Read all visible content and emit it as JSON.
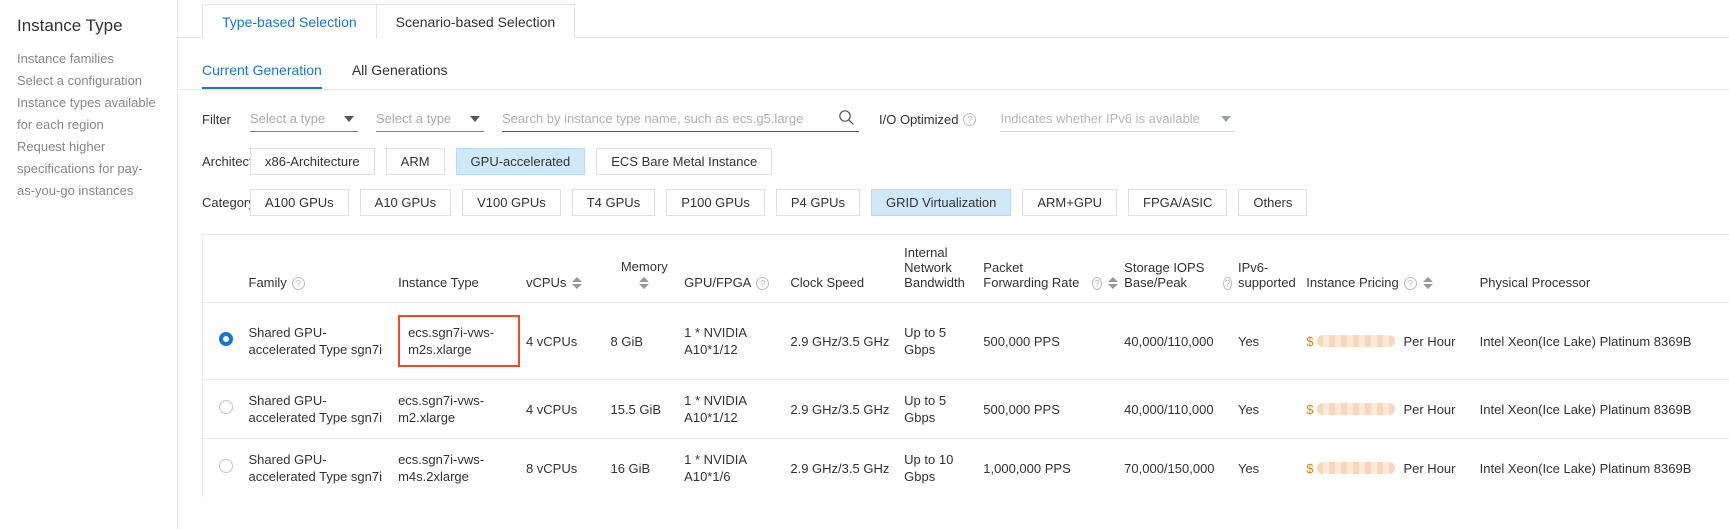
{
  "sidebar": {
    "title": "Instance Type",
    "items": [
      {
        "label": "Instance families"
      },
      {
        "label": "Select a configuration"
      },
      {
        "label": "Instance types available"
      },
      {
        "label": "for each region"
      },
      {
        "label": "Request higher"
      },
      {
        "label": "specifications for pay-"
      },
      {
        "label": "as-you-go instances"
      }
    ]
  },
  "top_tabs": [
    {
      "label": "Type-based Selection",
      "active": true
    },
    {
      "label": "Scenario-based Selection",
      "active": false
    }
  ],
  "sub_tabs": [
    {
      "label": "Current Generation",
      "active": true
    },
    {
      "label": "All Generations",
      "active": false
    }
  ],
  "filter": {
    "label": "Filter",
    "select1_placeholder": "Select a type",
    "select2_placeholder": "Select a type",
    "search_placeholder": "Search by instance type name, such as ecs.g5.large",
    "search_value": "",
    "io_optimized_label": "I/O Optimized",
    "ipv6_placeholder": "Indicates whether IPv6 is available"
  },
  "architecture": {
    "label": "Architecture",
    "options": [
      {
        "label": "x86-Architecture",
        "selected": false
      },
      {
        "label": "ARM",
        "selected": false
      },
      {
        "label": "GPU-accelerated",
        "selected": true
      },
      {
        "label": "ECS Bare Metal Instance",
        "selected": false
      }
    ]
  },
  "category": {
    "label": "Category",
    "options": [
      {
        "label": "A100 GPUs",
        "selected": false
      },
      {
        "label": "A10 GPUs",
        "selected": false
      },
      {
        "label": "V100 GPUs",
        "selected": false
      },
      {
        "label": "T4 GPUs",
        "selected": false
      },
      {
        "label": "P100 GPUs",
        "selected": false
      },
      {
        "label": "P4 GPUs",
        "selected": false
      },
      {
        "label": "GRID Virtualization",
        "selected": true
      },
      {
        "label": "ARM+GPU",
        "selected": false
      },
      {
        "label": "FPGA/ASIC",
        "selected": false
      },
      {
        "label": "Others",
        "selected": false
      }
    ]
  },
  "table": {
    "columns": [
      {
        "label": "Family",
        "help": true,
        "sort": false
      },
      {
        "label": "Instance Type",
        "help": false,
        "sort": false
      },
      {
        "label": "vCPUs",
        "help": false,
        "sort": true
      },
      {
        "label": "Memory",
        "help": false,
        "sort": true
      },
      {
        "label": "GPU/FPGA",
        "help": true,
        "sort": false
      },
      {
        "label": "Clock Speed",
        "help": false,
        "sort": false
      },
      {
        "label": "Internal Network Bandwidth",
        "help": false,
        "sort": false
      },
      {
        "label": "Packet Forwarding Rate",
        "help": true,
        "sort": true
      },
      {
        "label": "Storage IOPS Base/Peak",
        "help": true,
        "sort": false
      },
      {
        "label": "IPv6-supported",
        "help": false,
        "sort": false
      },
      {
        "label": "Instance Pricing",
        "help": true,
        "sort": true
      },
      {
        "label": "Physical Processor",
        "help": false,
        "sort": false
      }
    ],
    "rows": [
      {
        "selected": true,
        "highlight_instance_type": true,
        "family": "Shared GPU-accelerated Type sgn7i",
        "instance_type": "ecs.sgn7i-vws-m2s.xlarge",
        "vcpus": "4 vCPUs",
        "memory": "8 GiB",
        "gpu": "1 * NVIDIA A10*1/12",
        "clock_speed": "2.9 GHz/3.5 GHz",
        "bandwidth": "Up to 5 Gbps",
        "packet_rate": "500,000 PPS",
        "storage_iops": "40,000/110,000",
        "ipv6": "Yes",
        "price_currency": "$",
        "price_unit": "Per Hour",
        "processor": "Intel Xeon(Ice Lake) Platinum 8369B"
      },
      {
        "selected": false,
        "highlight_instance_type": false,
        "family": "Shared GPU-accelerated Type sgn7i",
        "instance_type": "ecs.sgn7i-vws-m2.xlarge",
        "vcpus": "4 vCPUs",
        "memory": "15.5 GiB",
        "gpu": "1 * NVIDIA A10*1/12",
        "clock_speed": "2.9 GHz/3.5 GHz",
        "bandwidth": "Up to 5 Gbps",
        "packet_rate": "500,000 PPS",
        "storage_iops": "40,000/110,000",
        "ipv6": "Yes",
        "price_currency": "$",
        "price_unit": "Per Hour",
        "processor": "Intel Xeon(Ice Lake) Platinum 8369B"
      },
      {
        "selected": false,
        "highlight_instance_type": false,
        "family": "Shared GPU-accelerated Type sgn7i",
        "instance_type": "ecs.sgn7i-vws-m4s.2xlarge",
        "vcpus": "8 vCPUs",
        "memory": "16 GiB",
        "gpu": "1 * NVIDIA A10*1/6",
        "clock_speed": "2.9 GHz/3.5 GHz",
        "bandwidth": "Up to 10 Gbps",
        "packet_rate": "1,000,000 PPS",
        "storage_iops": "70,000/150,000",
        "ipv6": "Yes",
        "price_currency": "$",
        "price_unit": "Per Hour",
        "processor": "Intel Xeon(Ice Lake) Platinum 8369B"
      }
    ]
  },
  "colors": {
    "accent": "#1677d2",
    "chip_selected_bg": "#cfe8fa",
    "highlight_border": "#ef4a23",
    "price_text": "#d48806"
  }
}
